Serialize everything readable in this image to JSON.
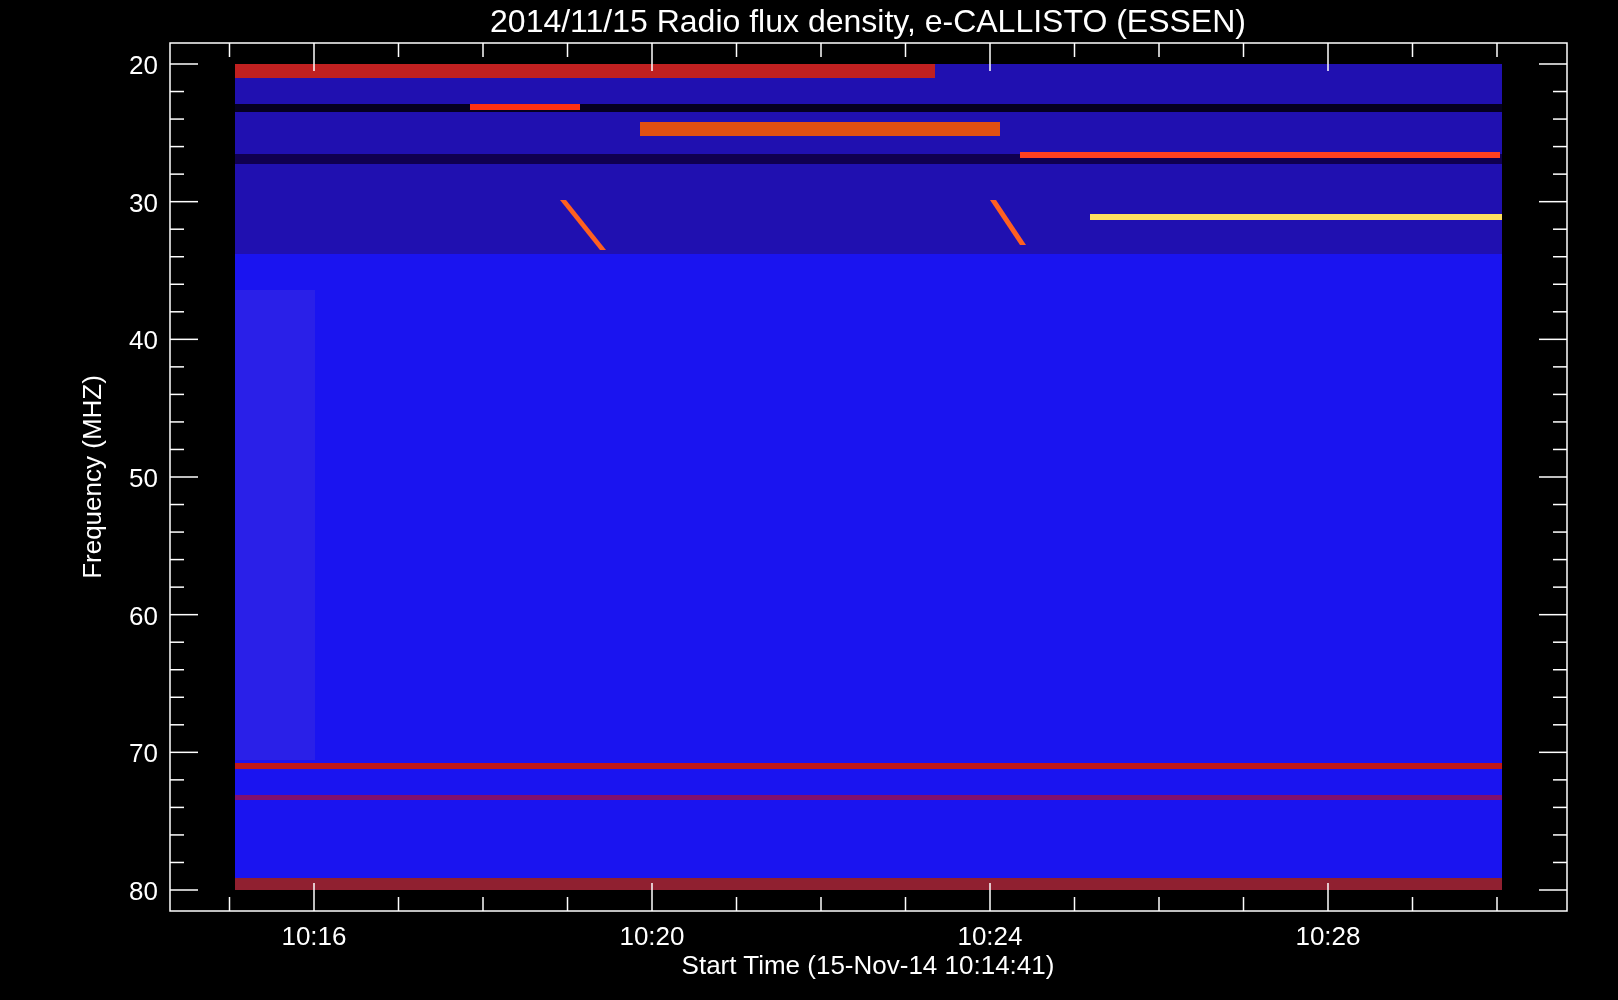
{
  "title": "2014/11/15  Radio flux density, e-CALLISTO (ESSEN)",
  "y_axis": {
    "label": "Frequency (MHZ)",
    "ticks": [
      "20",
      "30",
      "40",
      "50",
      "60",
      "70",
      "80"
    ]
  },
  "x_axis": {
    "label": "Start Time (15-Nov-14 10:14:41)",
    "ticks": [
      "10:16",
      "10:20",
      "10:24",
      "10:28"
    ]
  }
}
